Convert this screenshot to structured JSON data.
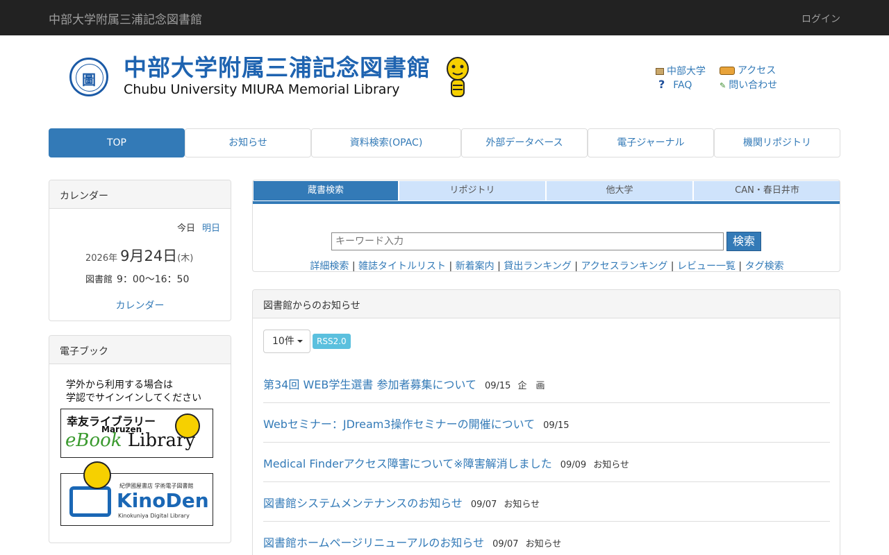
{
  "topbar": {
    "brand": "中部大学附属三浦記念図書館",
    "login": "ログイン"
  },
  "header": {
    "seal_text": "圖",
    "title_ja": "中部大学附属三浦記念図書館",
    "title_en": "Chubu University MIURA Memorial Library",
    "links": [
      {
        "label": "中部大学",
        "icon": "university-icon"
      },
      {
        "label": "アクセス",
        "icon": "bus-icon"
      },
      {
        "label": "FAQ",
        "icon": "question-icon"
      },
      {
        "label": "問い合わせ",
        "icon": "pencil-icon"
      }
    ]
  },
  "nav": [
    "TOP",
    "お知らせ",
    "資料検索(OPAC)",
    "外部データベース",
    "電子ジャーナル",
    "機関リポジトリ"
  ],
  "calendar": {
    "heading": "カレンダー",
    "today": "今日",
    "tomorrow": "明日",
    "year": "2026年",
    "date": "9月24日",
    "weekday": "(木)",
    "hours_label": "図書館",
    "hours": "9：00～16：50",
    "link": "カレンダー"
  },
  "ebook": {
    "heading": "電子ブック",
    "note1": "学外から利用する場合は",
    "note2": "学認でサインインしてください",
    "banner1": {
      "l1": "幸友ライブラリー",
      "l2": "Maruzen",
      "l3a": "eBook",
      "l3b": " Library"
    },
    "banner2": {
      "l1": "紀伊國屋書店 学術電子図書館",
      "l2": "KinoDen",
      "l3": "Kinokuniya Digital Library"
    }
  },
  "search": {
    "tabs": [
      "蔵書検索",
      "リポジトリ",
      "他大学",
      "CAN・春日井市"
    ],
    "placeholder": "キーワード入力",
    "button": "検索",
    "links": [
      "詳細検索",
      "雑誌タイトルリスト",
      "新着案内",
      "貸出ランキング",
      "アクセスランキング",
      "レビュー一覧",
      "タグ検索"
    ]
  },
  "news": {
    "heading": "図書館からのお知らせ",
    "count": "10件",
    "rss": "RSS2.0",
    "items": [
      {
        "title": "第34回 WEB学生選書 参加者募集について",
        "date": "09/15",
        "cat": "企　画"
      },
      {
        "title": "Webセミナー：JDream3操作セミナーの開催について",
        "date": "09/15",
        "cat": ""
      },
      {
        "title": "Medical Finderアクセス障害について※障害解消しました",
        "date": "09/09",
        "cat": "お知らせ"
      },
      {
        "title": "図書館システムメンテナンスのお知らせ",
        "date": "09/07",
        "cat": "お知らせ"
      },
      {
        "title": "図書館ホームページリニューアルのお知らせ",
        "date": "09/07",
        "cat": "お知らせ"
      }
    ]
  },
  "colors": {
    "primary": "#337ab7",
    "topbar": "#222222",
    "tab_light": "#cfe3fb",
    "rss": "#5bc0de"
  }
}
